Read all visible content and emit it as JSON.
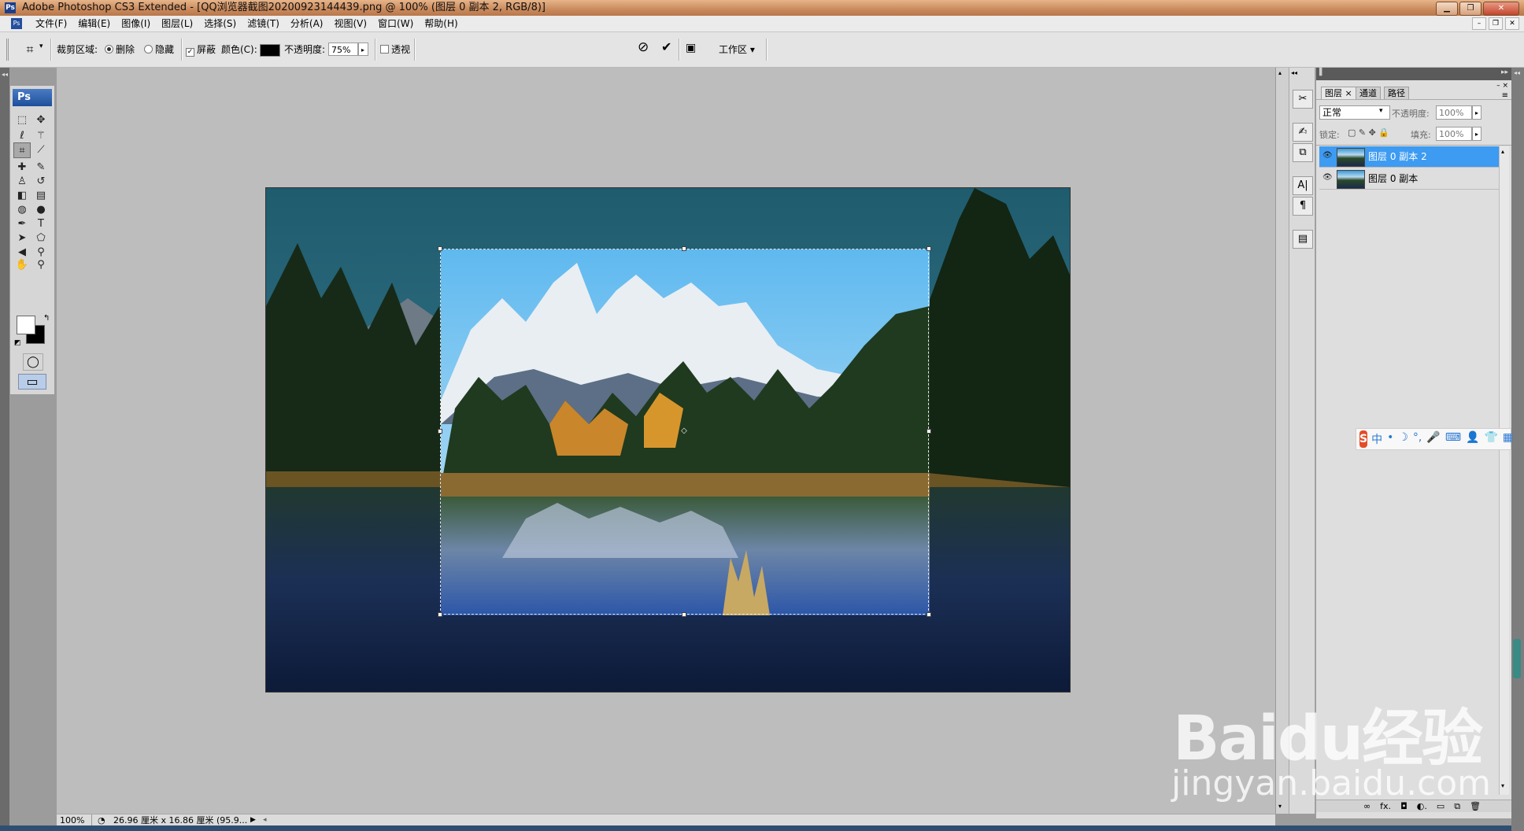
{
  "titlebar": {
    "app_icon": "Ps",
    "title": "Adobe Photoshop CS3 Extended - [QQ浏览器截图20200923144439.png @ 100% (图层 0 副本 2, RGB/8)]",
    "minimize_glyph": "▁",
    "restore_glyph": "❐",
    "close_glyph": "✕"
  },
  "menubar": {
    "doc_icon": "Ps",
    "items": [
      "文件(F)",
      "编辑(E)",
      "图像(I)",
      "图层(L)",
      "选择(S)",
      "滤镜(T)",
      "分析(A)",
      "视图(V)",
      "窗口(W)",
      "帮助(H)"
    ],
    "mdi_minimize": "–",
    "mdi_restore": "❐",
    "mdi_close": "✕"
  },
  "options": {
    "tool_icon": "crop-icon",
    "crop_area_label": "裁剪区域:",
    "delete_label": "删除",
    "hide_label": "隐藏",
    "shield_label": "屏蔽",
    "color_label": "颜色(C):",
    "opacity_label": "不透明度:",
    "opacity_value": "75%",
    "perspective_label": "透视",
    "cancel_glyph": "⊘",
    "commit_glyph": "✔",
    "workspace_label": "工作区 ▾",
    "shield_checked": true,
    "delete_selected": true,
    "shield_color": "#000000"
  },
  "toolbox": {
    "badge": "Ps",
    "tools": [
      {
        "name": "marquee-icon",
        "glyph": "⬚"
      },
      {
        "name": "move-icon",
        "glyph": "✥"
      },
      {
        "name": "lasso-icon",
        "glyph": "ℓ"
      },
      {
        "name": "magic-wand-icon",
        "glyph": "⚚"
      },
      {
        "name": "crop-tool-icon",
        "glyph": "⌗"
      },
      {
        "name": "slice-icon",
        "glyph": "⟋"
      },
      {
        "name": "healing-brush-icon",
        "glyph": "✚"
      },
      {
        "name": "brush-icon",
        "glyph": "✎"
      },
      {
        "name": "clone-stamp-icon",
        "glyph": "♙"
      },
      {
        "name": "history-brush-icon",
        "glyph": "↺"
      },
      {
        "name": "eraser-icon",
        "glyph": "◧"
      },
      {
        "name": "gradient-icon",
        "glyph": "▤"
      },
      {
        "name": "blur-icon",
        "glyph": "◍"
      },
      {
        "name": "dodge-icon",
        "glyph": "●"
      },
      {
        "name": "pen-icon",
        "glyph": "✒"
      },
      {
        "name": "type-icon",
        "glyph": "T"
      },
      {
        "name": "path-selection-icon",
        "glyph": "➤"
      },
      {
        "name": "shape-icon",
        "glyph": "⬠"
      },
      {
        "name": "notes-icon",
        "glyph": "◀"
      },
      {
        "name": "eyedropper-icon",
        "glyph": "⚲"
      },
      {
        "name": "hand-icon",
        "glyph": "✋"
      },
      {
        "name": "zoom-icon",
        "glyph": "⚲"
      }
    ],
    "fg_color": "#ffffff",
    "bg_color": "#000000",
    "quickmask_glyph": "◯",
    "screenmode_glyph": "▭"
  },
  "status": {
    "zoom": "100%",
    "doc_info": "26.96 厘米 x 16.86 厘米 (95.9...",
    "arrow": "▶"
  },
  "panel_icons": [
    "✂",
    "✍",
    "⧉",
    "A|",
    "¶",
    "▤"
  ],
  "layers": {
    "tabs": [
      "图层",
      "通道",
      "路径"
    ],
    "tab_close": "×",
    "blend_mode": "正常",
    "opacity_label": "不透明度:",
    "opacity_value": "100%",
    "lock_label": "锁定:",
    "fill_label": "填充:",
    "fill_value": "100%",
    "rows": [
      {
        "name": "图层 0 副本 2",
        "selected": true
      },
      {
        "name": "图层 0 副本",
        "selected": false
      }
    ],
    "bottom_icons": [
      "∞",
      "fx.",
      "◘",
      "◐.",
      "▭",
      "⧉",
      "🗑"
    ]
  },
  "ime": {
    "logo": "S",
    "items": [
      "中",
      "•",
      "☽",
      "°,",
      "🎤",
      "⌨",
      "👤",
      "👕",
      "▦"
    ]
  },
  "watermark": {
    "main": "Baidu经验",
    "sub": "jingyan.baidu.com"
  }
}
